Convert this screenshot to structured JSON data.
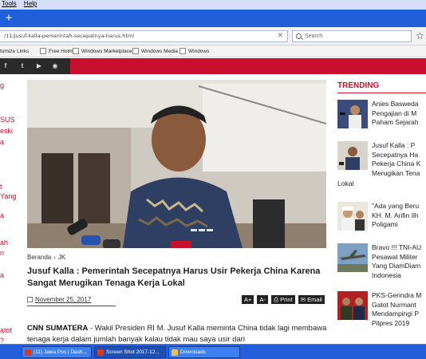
{
  "menu": {
    "items": [
      "Tools",
      "Help"
    ]
  },
  "browser": {
    "url": "/11/jusuf-kalla-pemerintah-secepatnya-harus.html",
    "search_placeholder": "Search",
    "bookmarks": [
      "tomize Links",
      "Free Hotmail",
      "Windows Marketplace",
      "Windows Media",
      "Windows"
    ]
  },
  "left_col": {
    "items": [
      {
        "text": "g"
      },
      {
        "text": "SUS"
      },
      {
        "text": "eski"
      },
      {
        "text": "a"
      },
      {
        "text": "t"
      },
      {
        "text": "Yang"
      },
      {
        "text": "a"
      },
      {
        "text": "ah"
      },
      {
        "text": "n"
      },
      {
        "text": "a"
      },
      {
        "text": "atot"
      },
      {
        "text": "?"
      }
    ]
  },
  "article": {
    "breadcrumb": [
      "Beranda",
      "JK"
    ],
    "breadcrumb_sep": "›",
    "title": "Jusuf Kalla : Pemerintah Secepatnya Harus Usir Pekerja China Karena Sangat Merugikan Tenaga Kerja Lokal",
    "date": "November 25, 2017",
    "tools": [
      "A+",
      "A-",
      "Print",
      "Email"
    ],
    "lead_source": "CNN SUMATERA",
    "lead_text": " - Wakil Presiden RI M. Jusuf Kalla meminta China tidak lagi membawa tenaga kerja dalam jumlah banyak kalau tidak mau saya usir dari"
  },
  "sidebar": {
    "label": "TRENDING",
    "items": [
      {
        "lines": [
          "Anies Basweda",
          "Pengajian di M",
          "Paham Sejarah"
        ],
        "thumb": "speaker"
      },
      {
        "lines": [
          "Jusuf Kalla : P",
          "Secepatnya Ha",
          "Pekerja China K",
          "Merugikan Tena"
        ],
        "wrap": "Lokal",
        "thumb": "jk"
      },
      {
        "lines": [
          "\"Ada yang Beru",
          "KH. M. Arifin Ilh",
          "Poligami"
        ],
        "thumb": "ulama"
      },
      {
        "lines": [
          "Bravo !!! TNI-AU",
          "Pesawat Militer",
          "Yang DiamDiam",
          "Indonesia"
        ],
        "thumb": "jet"
      },
      {
        "lines": [
          "PKS-Gerindra M",
          "Gatot Nurmant",
          "Mendampingi P",
          "Pilpres 2019"
        ],
        "thumb": "military"
      }
    ]
  },
  "taskbar": {
    "items": [
      {
        "label": "(11) Jawa Pos | Dash...",
        "color": "#d9381e"
      },
      {
        "label": "Screen Shot 2017-12...",
        "color": "#d9381e"
      },
      {
        "label": "Downloads",
        "color": "#f0c24b"
      }
    ]
  },
  "colors": {
    "brand": "#c8102e",
    "tabstrip": "#1f5fd9",
    "taskbar": "#245edb"
  }
}
